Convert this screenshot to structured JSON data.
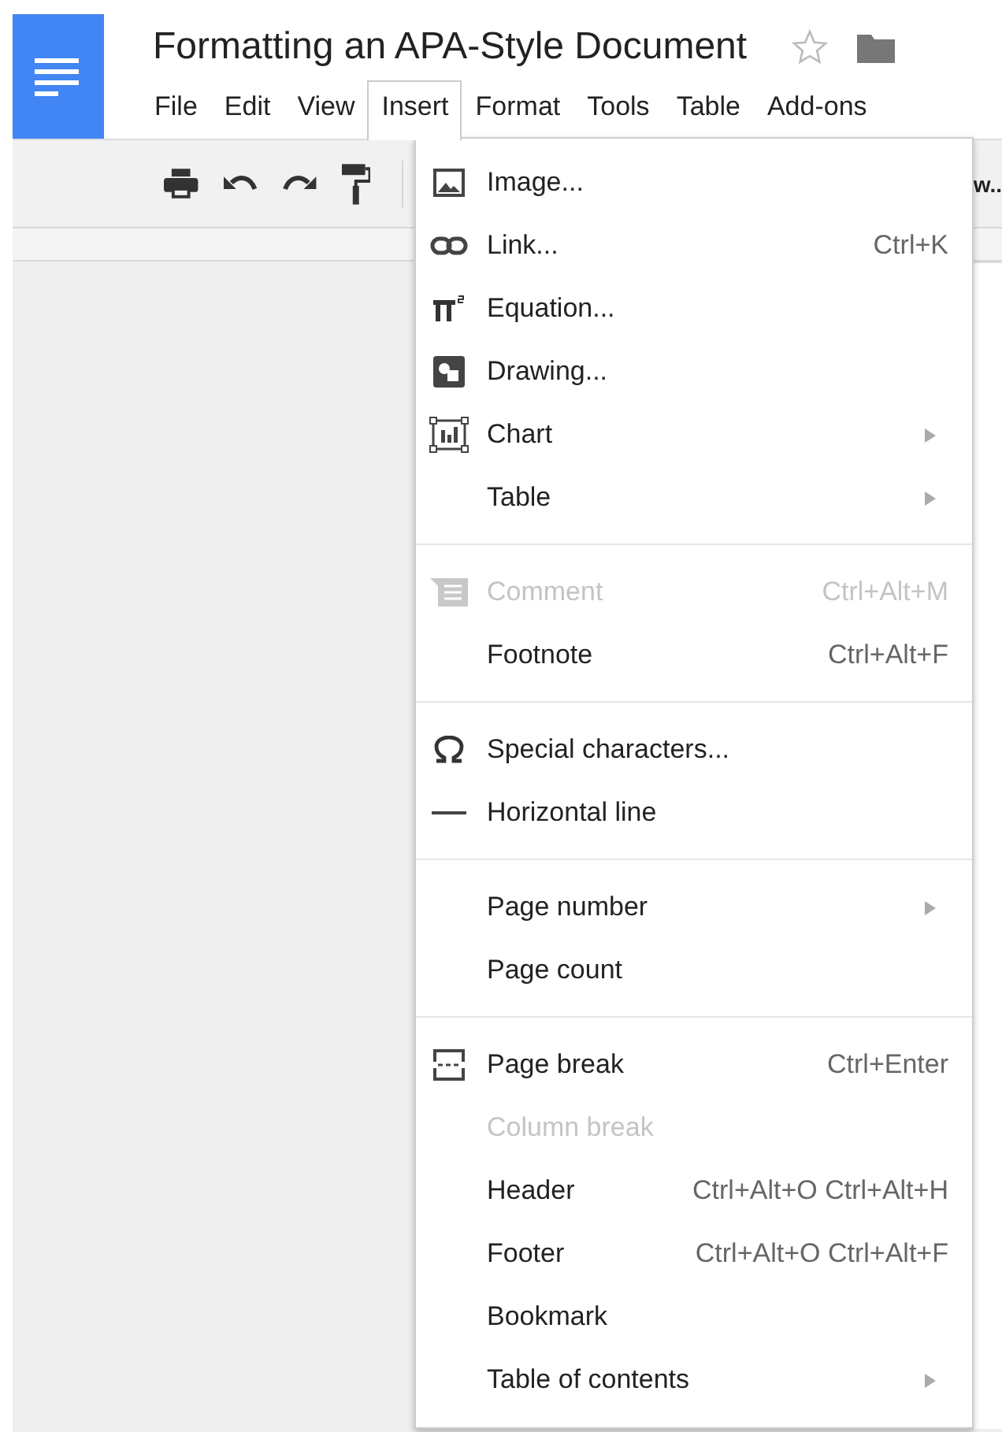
{
  "document": {
    "title": "Formatting an APA-Style Document",
    "starred": false
  },
  "menubar": [
    {
      "label": "File",
      "selected": false
    },
    {
      "label": "Edit",
      "selected": false
    },
    {
      "label": "View",
      "selected": false
    },
    {
      "label": "Insert",
      "selected": true
    },
    {
      "label": "Format",
      "selected": false
    },
    {
      "label": "Tools",
      "selected": false
    },
    {
      "label": "Table",
      "selected": false
    },
    {
      "label": "Add-ons",
      "selected": false
    }
  ],
  "toolbar": {
    "style_text": "w.."
  },
  "insert_menu": [
    [
      {
        "label": "Image...",
        "disabled": false
      },
      {
        "label": "Link...",
        "shortcut": "Ctrl+K",
        "disabled": false
      },
      {
        "label": "Equation...",
        "disabled": false
      },
      {
        "label": "Drawing...",
        "disabled": false
      },
      {
        "label": "Chart",
        "submenu": true,
        "disabled": false
      },
      {
        "label": "Table",
        "submenu": true,
        "disabled": false
      }
    ],
    [
      {
        "label": "Comment",
        "shortcut": "Ctrl+Alt+M",
        "disabled": true
      },
      {
        "label": "Footnote",
        "shortcut": "Ctrl+Alt+F",
        "disabled": false
      }
    ],
    [
      {
        "label": "Special characters...",
        "disabled": false
      },
      {
        "label": "Horizontal line",
        "disabled": false
      }
    ],
    [
      {
        "label": "Page number",
        "submenu": true,
        "disabled": false
      },
      {
        "label": "Page count",
        "disabled": false
      }
    ],
    [
      {
        "label": "Page break",
        "shortcut": "Ctrl+Enter",
        "disabled": false
      },
      {
        "label": "Column break",
        "disabled": true
      },
      {
        "label": "Header",
        "shortcut": "Ctrl+Alt+O Ctrl+Alt+H",
        "disabled": false
      },
      {
        "label": "Footer",
        "shortcut": "Ctrl+Alt+O Ctrl+Alt+F",
        "disabled": false
      },
      {
        "label": "Bookmark",
        "disabled": false
      },
      {
        "label": "Table of contents",
        "submenu": true,
        "disabled": false
      }
    ]
  ]
}
